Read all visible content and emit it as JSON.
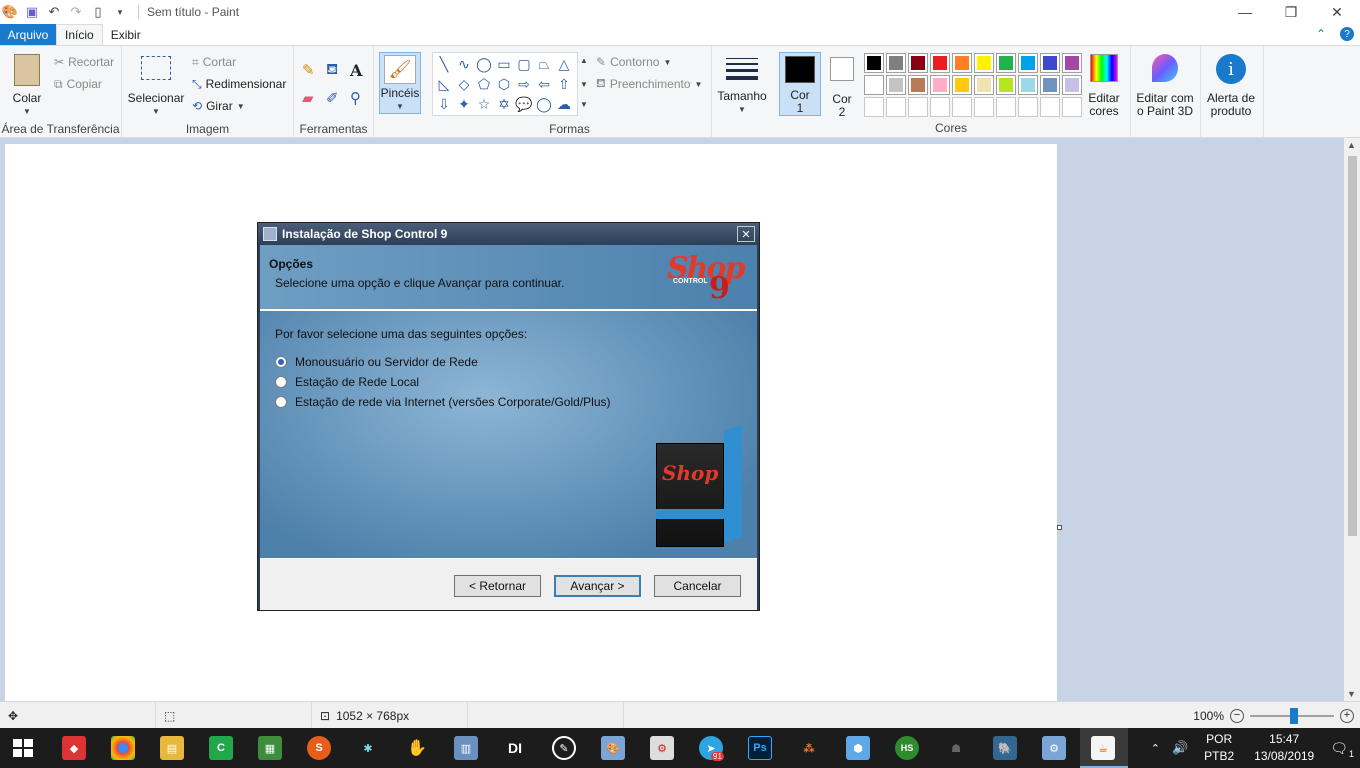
{
  "window": {
    "title": "Sem título - Paint"
  },
  "tabs": {
    "file": "Arquivo",
    "home": "Início",
    "view": "Exibir"
  },
  "ribbon": {
    "clipboard": {
      "paste": "Colar",
      "cut": "Recortar",
      "copy": "Copiar",
      "group": "Área de Transferência"
    },
    "image": {
      "select": "Selecionar",
      "crop": "Cortar",
      "resize": "Redimensionar",
      "rotate": "Girar",
      "group": "Imagem"
    },
    "tools": {
      "group": "Ferramentas"
    },
    "brushes": {
      "label": "Pincéis"
    },
    "shapes": {
      "outline": "Contorno",
      "fill": "Preenchimento",
      "group": "Formas"
    },
    "size": {
      "label": "Tamanho"
    },
    "color1": {
      "line1": "Cor",
      "line2": "1"
    },
    "color2": {
      "line1": "Cor",
      "line2": "2"
    },
    "colors": {
      "group": "Cores",
      "palette": [
        "#000000",
        "#7f7f7f",
        "#880015",
        "#ed1c24",
        "#ff7f27",
        "#fff200",
        "#22b14c",
        "#00a2e8",
        "#3f48cc",
        "#a349a4",
        "#ffffff",
        "#c3c3c3",
        "#b97a57",
        "#ffaec9",
        "#ffc90e",
        "#efe4b0",
        "#b5e61d",
        "#99d9ea",
        "#7092be",
        "#c8bfe7",
        "#ffffff",
        "#ffffff",
        "#ffffff",
        "#ffffff",
        "#ffffff",
        "#ffffff",
        "#ffffff",
        "#ffffff",
        "#ffffff",
        "#ffffff"
      ]
    },
    "edit_colors": {
      "line1": "Editar",
      "line2": "cores"
    },
    "paint3d": {
      "line1": "Editar com",
      "line2": "o Paint 3D"
    },
    "alert": {
      "line1": "Alerta de",
      "line2": "produto"
    }
  },
  "dialog": {
    "title": "Instalação de Shop Control 9",
    "header_title": "Opções",
    "header_subtitle": "Selecione uma opção e clique Avançar para continuar.",
    "logo_text": "Shop",
    "logo_sub": "CONTROL",
    "logo_num": "9",
    "prompt": "Por favor selecione uma das seguintes opções:",
    "options": [
      {
        "label": "Monousuário ou Servidor de Rede",
        "checked": true
      },
      {
        "label": "Estação de Rede Local",
        "checked": false
      },
      {
        "label": "Estação de rede via Internet (versões Corporate/Gold/Plus)",
        "checked": false
      }
    ],
    "buttons": {
      "back": "< Retornar",
      "next": "Avançar >",
      "cancel": "Cancelar"
    }
  },
  "statusbar": {
    "dimensions": "1052 × 768px",
    "zoom": "100%"
  },
  "taskbar": {
    "lang1": "POR",
    "lang2": "PTB2",
    "time": "15:47",
    "date": "13/08/2019",
    "notifications": "1",
    "telegram_badge": "91"
  }
}
